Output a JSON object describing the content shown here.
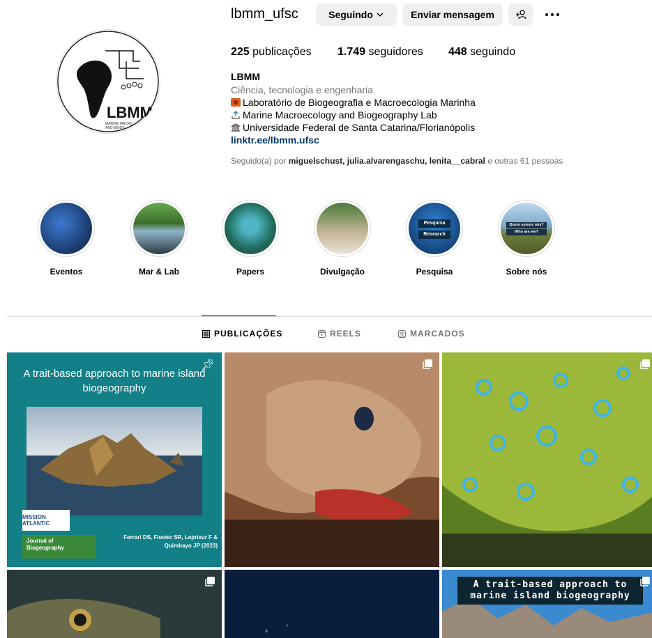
{
  "profile": {
    "username": "lbmm_ufsc",
    "follow_label": "Seguindo",
    "message_label": "Enviar mensagem",
    "avatar_text": "LBMM",
    "avatar_subtext_1": "MARINE MACRO",
    "avatar_subtext_2": "AND BIOGE"
  },
  "stats": {
    "posts_count": "225",
    "posts_label": "publicações",
    "followers_count": "1.749",
    "followers_label": "seguidores",
    "following_count": "448",
    "following_label": "seguindo"
  },
  "bio": {
    "name": "LBMM",
    "category": "Ciência, tecnologia e engenharia",
    "line1": "Laboratório de Biogeografia e Macroecologia Marinha",
    "line2": "Marine Macroecology and Biogeography Lab",
    "line3": "Universidade Federal de Santa Catarina/Florianópolis",
    "link": "linktr.ee/lbmm.ufsc",
    "followed_prefix": "Seguido(a) por",
    "followed_users": "miguelschust, julia.alvarengaschu, lenita__cabral",
    "followed_suffix": "e outras 61 pessoas"
  },
  "highlights": [
    {
      "label": "Eventos"
    },
    {
      "label": "Mar & Lab"
    },
    {
      "label": "Papers"
    },
    {
      "label": "Divulgação"
    },
    {
      "label": "Pesquisa",
      "inner_1": "Pesquisa",
      "inner_2": "Research"
    },
    {
      "label": "Sobre nós",
      "inner_1": "Quem somos nós?",
      "inner_2": "Who are we?"
    }
  ],
  "tabs": [
    {
      "label": "PUBLICAÇÕES",
      "active": true
    },
    {
      "label": "REELS",
      "active": false
    },
    {
      "label": "MARCADOS",
      "active": false
    }
  ],
  "posts": {
    "p1": {
      "title": "A trait-based approach to marine island biogeography",
      "mission": "MISSION ATLANTIC",
      "journal": "Journal of Biogeography",
      "authors": "Ferrari DS, Floeter SR, Leprieur F & Quimbayo JP (2023)"
    },
    "p6": {
      "caption": "A trait-based approach to marine island biogeography"
    }
  },
  "colors": {
    "link": "#00376b",
    "muted": "#737373",
    "button_bg": "#efefef",
    "border": "#dbdbdb"
  }
}
